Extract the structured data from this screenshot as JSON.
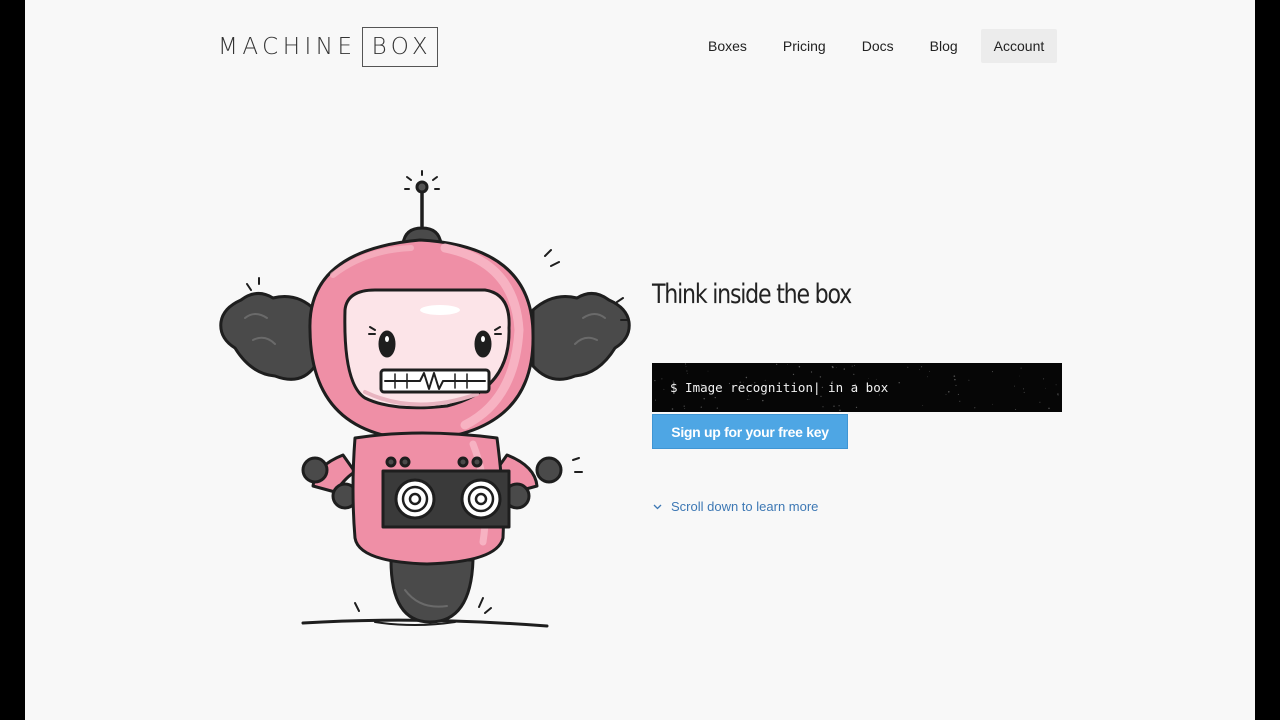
{
  "brand": {
    "word1": "MACHINE",
    "word2": "BOX"
  },
  "nav": {
    "items": [
      {
        "label": "Boxes"
      },
      {
        "label": "Pricing"
      },
      {
        "label": "Docs"
      },
      {
        "label": "Blog"
      },
      {
        "label": "Account"
      }
    ]
  },
  "hero": {
    "headline": "Think inside the box",
    "terminal_line": "$ Image recognition| in a box",
    "signup_label": "Sign up for your free key",
    "scroll_label": "Scroll down to learn more"
  },
  "colors": {
    "robot_pink": "#ef8fa6",
    "button_blue": "#4ea6e4",
    "link_blue": "#3d78b4",
    "terminal_bg": "#060606"
  },
  "icons": {
    "scroll": "chevron-down-icon"
  }
}
